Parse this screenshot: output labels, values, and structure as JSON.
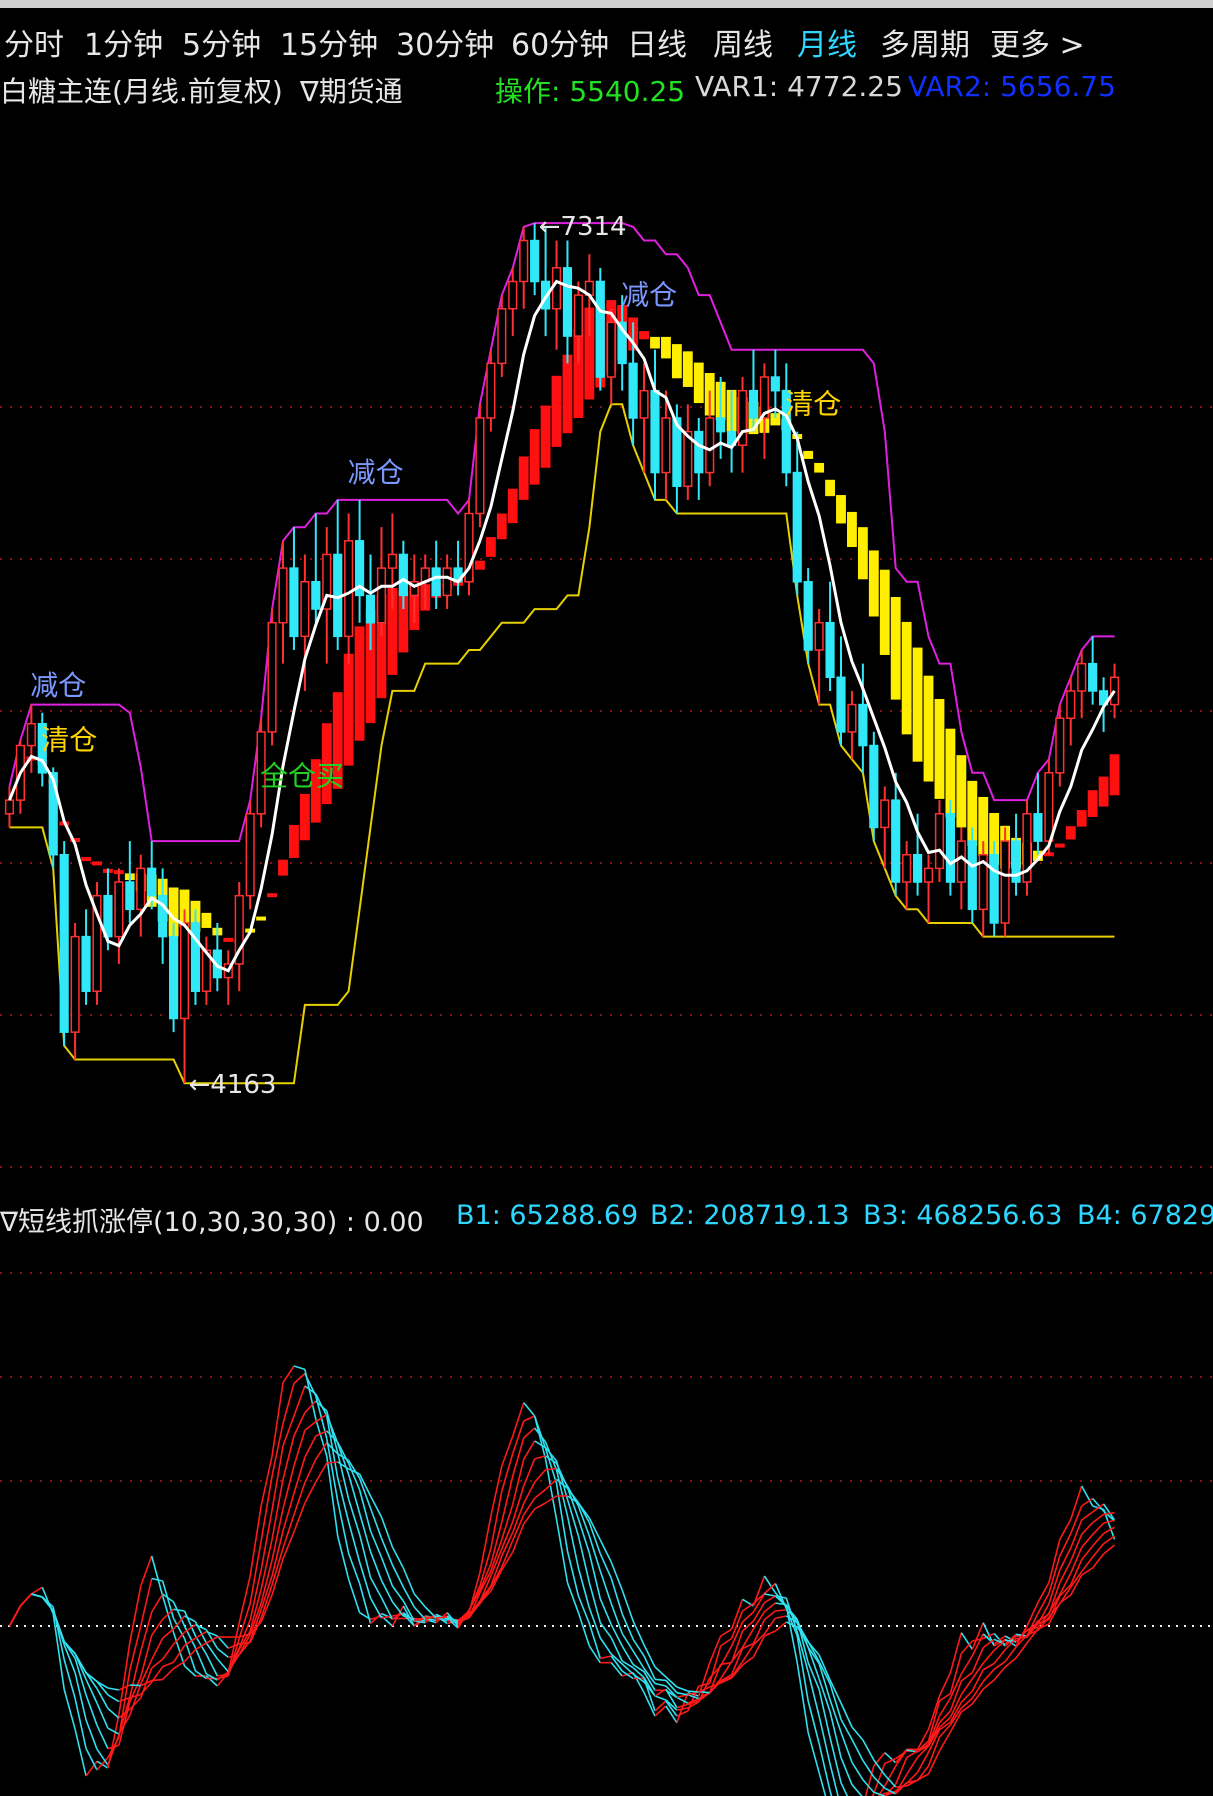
{
  "toolbar": {
    "tabs": [
      "分时",
      "1分钟",
      "5分钟",
      "15分钟",
      "30分钟",
      "60分钟",
      "日线",
      "周线",
      "月线",
      "多周期",
      "更多 >"
    ],
    "active": "月线"
  },
  "main": {
    "title": "白糖主连(月线.前复权)",
    "source": "∇期货通",
    "ops_label": "操作: 5540.25",
    "var1_label": "VAR1: 4772.25",
    "var2_label": "VAR2: 5656.75",
    "colors": {
      "ops": "#22e022",
      "var1": "#d8d8d8",
      "var2": "#1030ff"
    }
  },
  "indicator": {
    "title": "∇短线抓涨停(10,30,30,30) : 0.00",
    "b1": "B1: 65288.69",
    "b2": "B2: 208719.13",
    "b3": "B3: 468256.63",
    "b4": "B4: 67829"
  },
  "chart_data": {
    "type": "candlestick",
    "high_label": "7314",
    "low_label": "4163",
    "signals": [
      {
        "text": "减仓",
        "index": 3,
        "color": "#7b98ff"
      },
      {
        "text": "清仓",
        "index": 4,
        "color": "#ffd400"
      },
      {
        "text": "全仓买",
        "index": 24,
        "color": "#22d022"
      },
      {
        "text": "减仓",
        "index": 32,
        "color": "#7b98ff"
      },
      {
        "text": "减仓",
        "index": 57,
        "color": "#7b98ff"
      },
      {
        "text": "清仓",
        "index": 72,
        "color": "#ffd400"
      }
    ],
    "candles": [
      [
        5150,
        5250,
        5100,
        5200
      ],
      [
        5200,
        5420,
        5150,
        5400
      ],
      [
        5400,
        5550,
        5300,
        5480
      ],
      [
        5480,
        5520,
        5250,
        5300
      ],
      [
        5300,
        5320,
        4950,
        5000
      ],
      [
        5000,
        5050,
        4300,
        4350
      ],
      [
        4350,
        4750,
        4250,
        4700
      ],
      [
        4700,
        4800,
        4450,
        4500
      ],
      [
        4500,
        4900,
        4450,
        4850
      ],
      [
        4850,
        4950,
        4650,
        4700
      ],
      [
        4700,
        4950,
        4600,
        4900
      ],
      [
        4900,
        5050,
        4750,
        4800
      ],
      [
        4800,
        5000,
        4700,
        4950
      ],
      [
        4950,
        5050,
        4800,
        4850
      ],
      [
        4850,
        4950,
        4600,
        4700
      ],
      [
        4700,
        4750,
        4350,
        4400
      ],
      [
        4400,
        4800,
        4163,
        4750
      ],
      [
        4750,
        4800,
        4450,
        4500
      ],
      [
        4500,
        4700,
        4450,
        4650
      ],
      [
        4650,
        4750,
        4500,
        4550
      ],
      [
        4550,
        4650,
        4450,
        4600
      ],
      [
        4600,
        4900,
        4500,
        4850
      ],
      [
        4850,
        5200,
        4800,
        5150
      ],
      [
        5150,
        5500,
        5100,
        5450
      ],
      [
        5450,
        5900,
        5400,
        5850
      ],
      [
        5850,
        6150,
        5700,
        6050
      ],
      [
        6050,
        6200,
        5750,
        5800
      ],
      [
        5800,
        6100,
        5600,
        6000
      ],
      [
        6000,
        6250,
        5850,
        5900
      ],
      [
        5900,
        6200,
        5700,
        6100
      ],
      [
        6100,
        6300,
        5750,
        5800
      ],
      [
        5800,
        6250,
        5700,
        6150
      ],
      [
        6150,
        6300,
        5850,
        5950
      ],
      [
        5950,
        6100,
        5750,
        5850
      ],
      [
        5850,
        6200,
        5800,
        6050
      ],
      [
        6050,
        6250,
        5900,
        6100
      ],
      [
        6100,
        6150,
        5900,
        5950
      ],
      [
        5950,
        6100,
        5850,
        6000
      ],
      [
        6000,
        6100,
        5900,
        6050
      ],
      [
        6050,
        6150,
        5900,
        5950
      ],
      [
        5950,
        6100,
        5900,
        6050
      ],
      [
        6050,
        6150,
        5950,
        6000
      ],
      [
        6000,
        6300,
        5950,
        6250
      ],
      [
        6250,
        6650,
        6200,
        6600
      ],
      [
        6600,
        6850,
        6550,
        6800
      ],
      [
        6800,
        7050,
        6750,
        7000
      ],
      [
        7000,
        7150,
        6900,
        7100
      ],
      [
        7100,
        7300,
        7000,
        7250
      ],
      [
        7250,
        7314,
        7050,
        7100
      ],
      [
        7100,
        7300,
        6900,
        7000
      ],
      [
        7000,
        7250,
        6850,
        7150
      ],
      [
        7150,
        7250,
        6800,
        6900
      ],
      [
        6900,
        7100,
        6800,
        7050
      ],
      [
        7050,
        7200,
        6900,
        7100
      ],
      [
        7100,
        7150,
        6700,
        6750
      ],
      [
        6750,
        7000,
        6650,
        6950
      ],
      [
        6950,
        7050,
        6700,
        6800
      ],
      [
        6800,
        6950,
        6500,
        6600
      ],
      [
        6600,
        6800,
        6400,
        6700
      ],
      [
        6700,
        6850,
        6300,
        6400
      ],
      [
        6400,
        6700,
        6300,
        6600
      ],
      [
        6600,
        6650,
        6250,
        6350
      ],
      [
        6350,
        6650,
        6300,
        6550
      ],
      [
        6550,
        6600,
        6300,
        6400
      ],
      [
        6400,
        6700,
        6350,
        6600
      ],
      [
        6600,
        6750,
        6450,
        6550
      ],
      [
        6550,
        6700,
        6400,
        6500
      ],
      [
        6500,
        6750,
        6400,
        6700
      ],
      [
        6700,
        6850,
        6550,
        6600
      ],
      [
        6600,
        6800,
        6450,
        6750
      ],
      [
        6750,
        6850,
        6600,
        6700
      ],
      [
        6700,
        6800,
        6350,
        6400
      ],
      [
        6400,
        6550,
        5950,
        6000
      ],
      [
        6000,
        6050,
        5700,
        5750
      ],
      [
        5750,
        5900,
        5550,
        5850
      ],
      [
        5850,
        6000,
        5600,
        5650
      ],
      [
        5650,
        5800,
        5400,
        5450
      ],
      [
        5450,
        5600,
        5350,
        5550
      ],
      [
        5550,
        5700,
        5300,
        5400
      ],
      [
        5400,
        5450,
        5050,
        5100
      ],
      [
        5100,
        5250,
        4950,
        5200
      ],
      [
        5200,
        5300,
        4850,
        4900
      ],
      [
        4900,
        5050,
        4800,
        5000
      ],
      [
        5000,
        5150,
        4850,
        4900
      ],
      [
        4900,
        5000,
        4750,
        4950
      ],
      [
        4950,
        5200,
        4900,
        5150
      ],
      [
        5150,
        5200,
        4850,
        4900
      ],
      [
        4900,
        5100,
        4800,
        5050
      ],
      [
        5050,
        5100,
        4750,
        4800
      ],
      [
        4800,
        5050,
        4700,
        5000
      ],
      [
        5000,
        5050,
        4700,
        4750
      ],
      [
        4750,
        5100,
        4700,
        5050
      ],
      [
        5050,
        5150,
        4850,
        4900
      ],
      [
        4900,
        5200,
        4850,
        5150
      ],
      [
        5150,
        5300,
        5000,
        5050
      ],
      [
        5050,
        5350,
        5000,
        5300
      ],
      [
        5300,
        5550,
        5250,
        5500
      ],
      [
        5500,
        5650,
        5400,
        5600
      ],
      [
        5600,
        5750,
        5500,
        5700
      ],
      [
        5700,
        5800,
        5550,
        5600
      ],
      [
        5600,
        5650,
        5450,
        5550
      ],
      [
        5550,
        5700,
        5500,
        5650
      ]
    ]
  }
}
